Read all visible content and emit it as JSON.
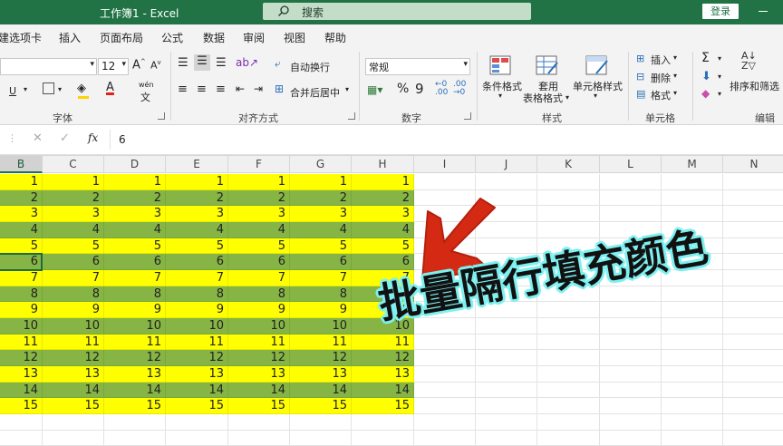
{
  "title_bar": {
    "title": "工作簿1  -  Excel",
    "search_placeholder": "搜索",
    "login_label": "登录"
  },
  "ribbon_tabs": [
    "建选项卡",
    "插入",
    "页面布局",
    "公式",
    "数据",
    "审阅",
    "视图",
    "帮助"
  ],
  "font": {
    "size": "12",
    "phonetic": "wén"
  },
  "ribbon": {
    "wrap_text": "自动换行",
    "merge_center": "合并后居中",
    "number_format": "常规",
    "conditional_format": "条件格式",
    "table_format_line1": "套用",
    "table_format_line2": "表格格式",
    "cell_style": "单元格样式",
    "insert": "插入",
    "delete": "删除",
    "format": "格式",
    "sort_filter": "排序和筛选",
    "group_labels": {
      "font": "字体",
      "alignment": "对齐方式",
      "number": "数字",
      "styles": "样式",
      "cells": "单元格",
      "editing": "编辑"
    }
  },
  "formula_bar": {
    "fx": "fx",
    "value": "6"
  },
  "columns": [
    "B",
    "C",
    "D",
    "E",
    "F",
    "G",
    "H",
    "I",
    "J",
    "K",
    "L",
    "M",
    "N"
  ],
  "selected_column": "B",
  "rows": [
    [
      "1",
      "1",
      "1",
      "1",
      "1",
      "1",
      "1"
    ],
    [
      "2",
      "2",
      "2",
      "2",
      "2",
      "2",
      "2"
    ],
    [
      "3",
      "3",
      "3",
      "3",
      "3",
      "3",
      "3"
    ],
    [
      "4",
      "4",
      "4",
      "4",
      "4",
      "4",
      "4"
    ],
    [
      "5",
      "5",
      "5",
      "5",
      "5",
      "5",
      "5"
    ],
    [
      "6",
      "6",
      "6",
      "6",
      "6",
      "6",
      "6"
    ],
    [
      "7",
      "7",
      "7",
      "7",
      "7",
      "7",
      "7"
    ],
    [
      "8",
      "8",
      "8",
      "8",
      "8",
      "8",
      "8"
    ],
    [
      "9",
      "9",
      "9",
      "9",
      "9",
      "9",
      "9"
    ],
    [
      "10",
      "10",
      "10",
      "10",
      "10",
      "10",
      "10"
    ],
    [
      "11",
      "11",
      "11",
      "11",
      "11",
      "11",
      "11"
    ],
    [
      "12",
      "12",
      "12",
      "12",
      "12",
      "12",
      "12"
    ],
    [
      "13",
      "13",
      "13",
      "13",
      "13",
      "13",
      "13"
    ],
    [
      "14",
      "14",
      "14",
      "14",
      "14",
      "14",
      "14"
    ],
    [
      "15",
      "15",
      "15",
      "15",
      "15",
      "15",
      "15"
    ]
  ],
  "row_fill_colors": [
    "#ffff00",
    "#86b545"
  ],
  "active_cell_value": "6",
  "overlay_caption": "批量隔行填充颜色",
  "accent_colors": {
    "excel_green": "#217346",
    "arrow_red": "#d42a14",
    "caption_outline": "#7ff0f0"
  }
}
